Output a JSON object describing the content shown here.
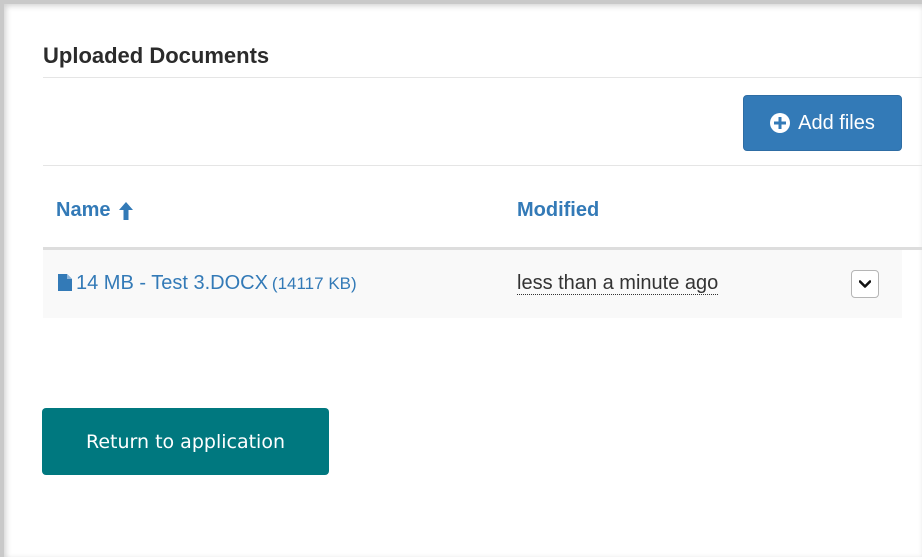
{
  "panel": {
    "title": "Uploaded Documents"
  },
  "toolbar": {
    "add_files_label": "Add files"
  },
  "table": {
    "columns": [
      {
        "label": "Name",
        "sort": "ascending"
      },
      {
        "label": "Modified"
      }
    ],
    "rows": [
      {
        "name": "14 MB - Test 3.DOCX",
        "size": "(14117 KB)",
        "modified": "less than a minute ago"
      }
    ]
  },
  "actions": {
    "return_label": "Return to application"
  },
  "colors": {
    "primary": "#337ab7",
    "teal": "#00787f",
    "row_bg": "#f9f9f9"
  },
  "icons": {
    "add": "plus-circle-icon",
    "sort": "arrow-up-icon",
    "file": "file-icon",
    "row_menu": "chevron-down-icon"
  }
}
